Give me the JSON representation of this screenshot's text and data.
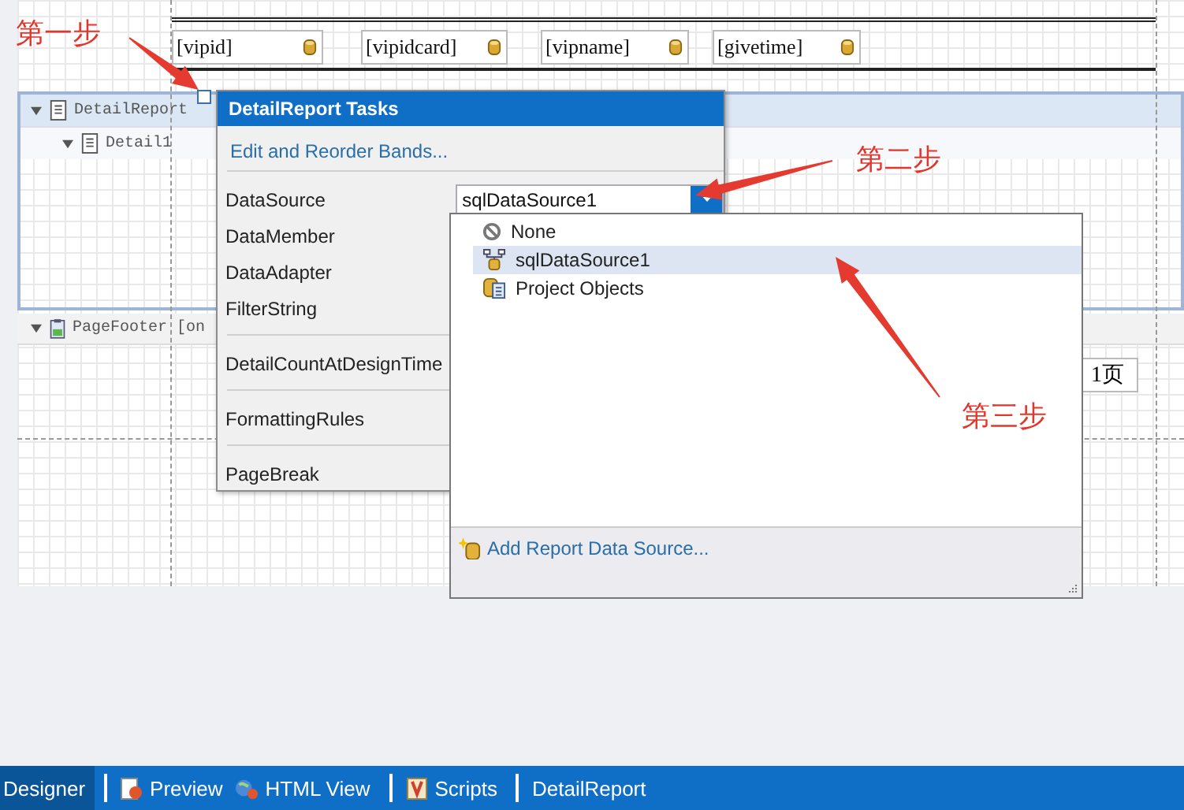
{
  "report": {
    "header_fields": [
      "[vipid]",
      "[vipidcard]",
      "[vipname]",
      "[givetime]"
    ],
    "bands": [
      {
        "label": "DetailReport",
        "kind": "report",
        "selected": true,
        "children": [
          {
            "label": "Detail1",
            "kind": "detail",
            "selected": false
          }
        ]
      },
      {
        "label": "PageFooter [on",
        "kind": "footer"
      }
    ],
    "page_number": "1页"
  },
  "tasks": {
    "title": "DetailReport Tasks",
    "link": "Edit and Reorder Bands...",
    "groups": [
      [
        {
          "name": "DataSource",
          "value": "sqlDataSource1"
        },
        {
          "name": "DataMember"
        },
        {
          "name": "DataAdapter"
        },
        {
          "name": "FilterString"
        }
      ],
      [
        {
          "name": "DetailCountAtDesignTime"
        }
      ],
      [
        {
          "name": "FormattingRules"
        }
      ],
      [
        {
          "name": "PageBreak"
        }
      ]
    ]
  },
  "dropdown": {
    "items": [
      {
        "label": "None",
        "kind": "none",
        "selected": false
      },
      {
        "label": "sqlDataSource1",
        "kind": "datasource",
        "selected": true
      },
      {
        "label": "Project Objects",
        "kind": "project",
        "selected": false
      }
    ],
    "footer_link": "Add Report Data Source..."
  },
  "annotations": [
    {
      "text": "第一步"
    },
    {
      "text": "第二步"
    },
    {
      "text": "第三步"
    }
  ],
  "tabs": [
    {
      "label": "Designer",
      "kind": "designer",
      "selected": true
    },
    {
      "label": "Preview",
      "kind": "preview",
      "selected": false
    },
    {
      "label": "HTML View",
      "kind": "html",
      "selected": false
    },
    {
      "label": "Scripts",
      "kind": "scripts",
      "selected": false
    },
    {
      "label": "DetailReport",
      "kind": "report",
      "selected": false
    }
  ]
}
